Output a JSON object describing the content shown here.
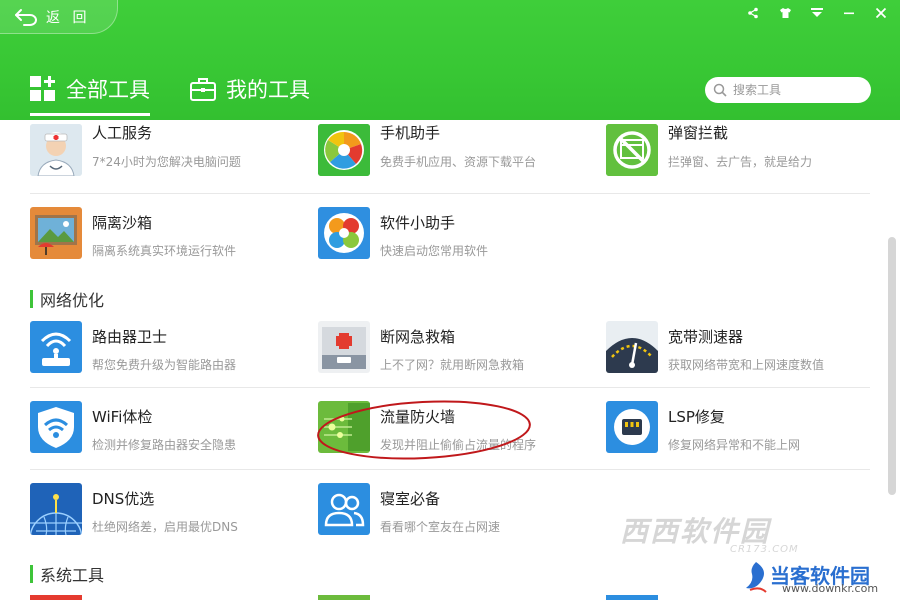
{
  "header": {
    "back_label": "返 回",
    "tabs": [
      {
        "label": "全部工具",
        "active": true
      },
      {
        "label": "我的工具",
        "active": false
      }
    ],
    "search_placeholder": "搜索工具"
  },
  "window_controls": [
    "share-icon",
    "shirt-icon",
    "menu-icon",
    "minimize-icon",
    "close-icon"
  ],
  "sections": [
    {
      "title": "网络优化"
    },
    {
      "title": "系统工具"
    }
  ],
  "rows": [
    [
      {
        "name": "人工服务",
        "desc": "7*24小时为您解决电脑问题",
        "icon": "doctor-icon"
      },
      {
        "name": "手机助手",
        "desc": "免费手机应用、资源下载平台",
        "icon": "phone-assistant-icon"
      },
      {
        "name": "弹窗拦截",
        "desc": "拦弹窗、去广告，就是给力",
        "icon": "popup-block-icon"
      }
    ],
    [
      {
        "name": "隔离沙箱",
        "desc": "隔离系统真实环境运行软件",
        "icon": "sandbox-icon"
      },
      {
        "name": "软件小助手",
        "desc": "快速启动您常用软件",
        "icon": "software-helper-icon"
      }
    ],
    [
      {
        "name": "路由器卫士",
        "desc": "帮您免费升级为智能路由器",
        "icon": "router-icon"
      },
      {
        "name": "断网急救箱",
        "desc": "上不了网？就用断网急救箱",
        "icon": "first-aid-icon"
      },
      {
        "name": "宽带测速器",
        "desc": "获取网络带宽和上网速度数值",
        "icon": "speedometer-icon"
      }
    ],
    [
      {
        "name": "WiFi体检",
        "desc": "检测并修复路由器安全隐患",
        "icon": "wifi-shield-icon"
      },
      {
        "name": "流量防火墙",
        "desc": "发现并阻止偷偷占流量的程序",
        "icon": "firewall-icon"
      },
      {
        "name": "LSP修复",
        "desc": "修复网络异常和不能上网",
        "icon": "lsp-repair-icon"
      }
    ],
    [
      {
        "name": "DNS优选",
        "desc": "杜绝网络差，启用最优DNS",
        "icon": "dns-globe-icon"
      },
      {
        "name": "寝室必备",
        "desc": "看看哪个室友在占网速",
        "icon": "dorm-users-icon"
      }
    ]
  ],
  "colors": {
    "header_green": "#38c734",
    "section_bar": "#3ec439",
    "annotation_red": "#c0181b"
  },
  "watermarks": {
    "site1": "西西软件园",
    "site1_sub": "CR173.COM",
    "site2": "当客软件园",
    "site2_sub": "www.downkr.com"
  }
}
